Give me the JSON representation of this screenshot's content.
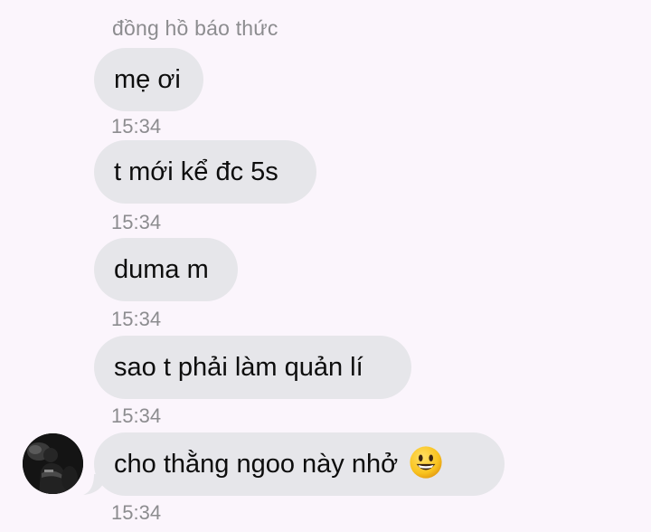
{
  "conversation": {
    "sender_name": "đồng hồ báo thức",
    "messages": [
      {
        "text": "mẹ ơi",
        "time": "15:34"
      },
      {
        "text": "t mới kể đc 5s",
        "time": "15:34"
      },
      {
        "text": "duma m",
        "time": "15:34"
      },
      {
        "text": "sao t phải làm quản lí",
        "time": "15:34"
      },
      {
        "text": "cho thằng ngoo này nhở",
        "time": "15:34",
        "emoji": "smiley-emoji"
      }
    ]
  },
  "colors": {
    "background": "#fbf5fc",
    "bubble": "#e6e6ea",
    "text": "#0d0d0d",
    "meta_text": "#8c8c8f"
  }
}
